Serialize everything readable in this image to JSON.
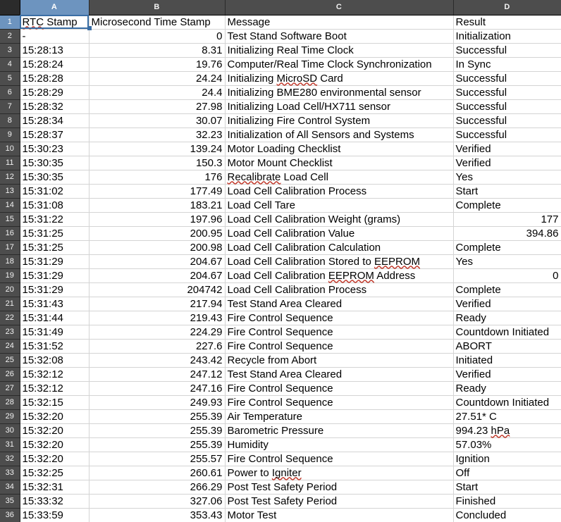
{
  "app": {
    "type": "spreadsheet",
    "selected_cell": "A1",
    "accent_color": "#3a6ea5",
    "header_bg": "#4d4d4d",
    "header_selected_bg": "#6d94bf",
    "grid_line_color": "#d4d4d4",
    "spellcheck_color": "#c0392b"
  },
  "columns": [
    {
      "id": "A",
      "label": "A",
      "selected": true,
      "align": "left"
    },
    {
      "id": "B",
      "label": "B",
      "selected": false,
      "align": "right"
    },
    {
      "id": "C",
      "label": "C",
      "selected": false,
      "align": "left"
    },
    {
      "id": "D",
      "label": "D",
      "selected": false,
      "align": "left"
    }
  ],
  "header_row": {
    "number": "1",
    "A": "RTC Stamp",
    "B": "Microsecond Time Stamp",
    "C": "Message",
    "D": "Result",
    "spellcheck": [
      "RTC"
    ]
  },
  "table_data": {
    "type": "table",
    "columns": [
      "RTC Stamp",
      "Microsecond Time Stamp",
      "Message",
      "Result"
    ],
    "rows": [
      {
        "n": "2",
        "a": "-",
        "b": "0",
        "c": "Test Stand Software Boot",
        "d": "Initialization",
        "b_num": true,
        "d_num": false
      },
      {
        "n": "3",
        "a": "15:28:13",
        "b": "8.31",
        "c": "Initializing Real Time Clock",
        "d": "Successful",
        "b_num": true,
        "d_num": false
      },
      {
        "n": "4",
        "a": "15:28:24",
        "b": "19.76",
        "c": "Computer/Real Time Clock Synchronization",
        "d": "In Sync",
        "b_num": true,
        "d_num": false
      },
      {
        "n": "5",
        "a": "15:28:28",
        "b": "24.24",
        "c": "Initializing MicroSD Card",
        "d": "Successful",
        "b_num": true,
        "d_num": false,
        "sq": "MicroSD"
      },
      {
        "n": "6",
        "a": "15:28:29",
        "b": "24.4",
        "c": "Initializing BME280 environmental sensor",
        "d": "Successful",
        "b_num": true,
        "d_num": false
      },
      {
        "n": "7",
        "a": "15:28:32",
        "b": "27.98",
        "c": "Initializing Load Cell/HX711 sensor",
        "d": "Successful",
        "b_num": true,
        "d_num": false
      },
      {
        "n": "8",
        "a": "15:28:34",
        "b": "30.07",
        "c": "Initializing Fire Control System",
        "d": "Successful",
        "b_num": true,
        "d_num": false
      },
      {
        "n": "9",
        "a": "15:28:37",
        "b": "32.23",
        "c": "Initialization of All Sensors and Systems",
        "d": "Successful",
        "b_num": true,
        "d_num": false
      },
      {
        "n": "10",
        "a": "15:30:23",
        "b": "139.24",
        "c": "Motor Loading Checklist",
        "d": "Verified",
        "b_num": true,
        "d_num": false
      },
      {
        "n": "11",
        "a": "15:30:35",
        "b": "150.3",
        "c": "Motor Mount Checklist",
        "d": "Verified",
        "b_num": true,
        "d_num": false
      },
      {
        "n": "12",
        "a": "15:30:35",
        "b": "176",
        "c": "Recalibrate Load Cell",
        "d": "Yes",
        "b_num": true,
        "d_num": false,
        "sq": "Recalibrate"
      },
      {
        "n": "13",
        "a": "15:31:02",
        "b": "177.49",
        "c": "Load Cell Calibration Process",
        "d": "Start",
        "b_num": true,
        "d_num": false
      },
      {
        "n": "14",
        "a": "15:31:08",
        "b": "183.21",
        "c": "Load Cell Tare",
        "d": "Complete",
        "b_num": true,
        "d_num": false
      },
      {
        "n": "15",
        "a": "15:31:22",
        "b": "197.96",
        "c": "Load Cell Calibration Weight (grams)",
        "d": "177",
        "b_num": true,
        "d_num": true
      },
      {
        "n": "16",
        "a": "15:31:25",
        "b": "200.95",
        "c": "Load Cell Calibration Value",
        "d": "394.86",
        "b_num": true,
        "d_num": true
      },
      {
        "n": "17",
        "a": "15:31:25",
        "b": "200.98",
        "c": "Load Cell Calibration Calculation",
        "d": "Complete",
        "b_num": true,
        "d_num": false
      },
      {
        "n": "18",
        "a": "15:31:29",
        "b": "204.67",
        "c": "Load Cell Calibration Stored to EEPROM",
        "d": "Yes",
        "b_num": true,
        "d_num": false,
        "sq": "EEPROM"
      },
      {
        "n": "19",
        "a": "15:31:29",
        "b": "204.67",
        "c": "Load Cell Calibration EEPROM Address",
        "d": "0",
        "b_num": true,
        "d_num": true,
        "sq": "EEPROM"
      },
      {
        "n": "20",
        "a": "15:31:29",
        "b": "204742",
        "c": "Load Cell Calibration Process",
        "d": "Complete",
        "b_num": true,
        "d_num": false
      },
      {
        "n": "21",
        "a": "15:31:43",
        "b": "217.94",
        "c": "Test Stand Area Cleared",
        "d": "Verified",
        "b_num": true,
        "d_num": false
      },
      {
        "n": "22",
        "a": "15:31:44",
        "b": "219.43",
        "c": "Fire Control Sequence",
        "d": "Ready",
        "b_num": true,
        "d_num": false
      },
      {
        "n": "23",
        "a": "15:31:49",
        "b": "224.29",
        "c": "Fire Control Sequence",
        "d": "Countdown Initiated",
        "b_num": true,
        "d_num": false
      },
      {
        "n": "24",
        "a": "15:31:52",
        "b": "227.6",
        "c": "Fire Control Sequence",
        "d": "ABORT",
        "b_num": true,
        "d_num": false
      },
      {
        "n": "25",
        "a": "15:32:08",
        "b": "243.42",
        "c": "Recycle from Abort",
        "d": "Initiated",
        "b_num": true,
        "d_num": false
      },
      {
        "n": "26",
        "a": "15:32:12",
        "b": "247.12",
        "c": "Test Stand Area Cleared",
        "d": "Verified",
        "b_num": true,
        "d_num": false
      },
      {
        "n": "27",
        "a": "15:32:12",
        "b": "247.16",
        "c": "Fire Control Sequence",
        "d": "Ready",
        "b_num": true,
        "d_num": false
      },
      {
        "n": "28",
        "a": "15:32:15",
        "b": "249.93",
        "c": "Fire Control Sequence",
        "d": "Countdown Initiated",
        "b_num": true,
        "d_num": false
      },
      {
        "n": "29",
        "a": "15:32:20",
        "b": "255.39",
        "c": "Air Temperature",
        "d": "27.51* C",
        "b_num": true,
        "d_num": false
      },
      {
        "n": "30",
        "a": "15:32:20",
        "b": "255.39",
        "c": "Barometric Pressure",
        "d": "994.23 hPa",
        "b_num": true,
        "d_num": false,
        "dsq": "hPa"
      },
      {
        "n": "31",
        "a": "15:32:20",
        "b": "255.39",
        "c": "Humidity",
        "d": "57.03%",
        "b_num": true,
        "d_num": false
      },
      {
        "n": "32",
        "a": "15:32:20",
        "b": "255.57",
        "c": "Fire Control Sequence",
        "d": "Ignition",
        "b_num": true,
        "d_num": false
      },
      {
        "n": "33",
        "a": "15:32:25",
        "b": "260.61",
        "c": "Power to Igniter",
        "d": "Off",
        "b_num": true,
        "d_num": false,
        "sq": "Igniter"
      },
      {
        "n": "34",
        "a": "15:32:31",
        "b": "266.29",
        "c": "Post Test Safety Period",
        "d": "Start",
        "b_num": true,
        "d_num": false
      },
      {
        "n": "35",
        "a": "15:33:32",
        "b": "327.06",
        "c": "Post Test Safety Period",
        "d": "Finished",
        "b_num": true,
        "d_num": false
      },
      {
        "n": "36",
        "a": "15:33:59",
        "b": "353.43",
        "c": "Motor Test",
        "d": "Concluded",
        "b_num": true,
        "d_num": false
      }
    ]
  }
}
